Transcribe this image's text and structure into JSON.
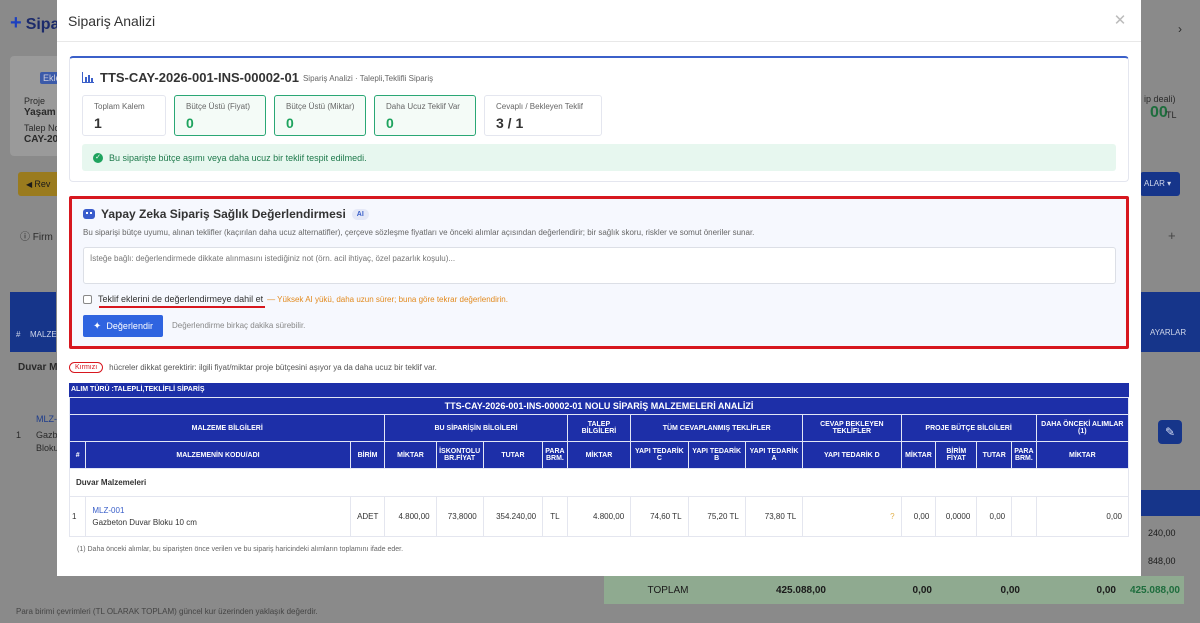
{
  "background": {
    "title": "Sipar",
    "labels": [
      "Ekle",
      "Proje",
      "Yaşam",
      "Talep No",
      "CAY-20",
      "Rev",
      "Firm",
      "#",
      "MALZE",
      "Duvar M",
      "MLZ-",
      "Gazbe",
      "Bloku",
      "1"
    ],
    "right_labels": [
      "ip deali)",
      "00",
      "TL",
      "ALAR",
      "AYARLAR",
      "240,00",
      "848,00"
    ],
    "totals": {
      "label": "TOPLAM",
      "v1": "425.088,00",
      "v2": "0,00",
      "v3": "0,00",
      "v4": "0,00",
      "v5": "425.088,00"
    },
    "footer": "Para birimi çevrimleri (TL OLARAK TOPLAM) güncel kur üzerinden yaklaşık değerdir."
  },
  "modal": {
    "title": "Sipariş Analizi",
    "summary": {
      "code": "TTS-CAY-2026-001-INS-00002-01",
      "subtitle": "Sipariş Analizi · Talepli,Teklifli Sipariş",
      "stats": [
        {
          "label": "Toplam Kalem",
          "value": "1",
          "highlight": false
        },
        {
          "label": "Bütçe Üstü (Fiyat)",
          "value": "0",
          "highlight": true
        },
        {
          "label": "Bütçe Üstü (Miktar)",
          "value": "0",
          "highlight": true
        },
        {
          "label": "Daha Ucuz Teklif Var",
          "value": "0",
          "highlight": true
        },
        {
          "label": "Cevaplı / Bekleyen Teklif",
          "value": "3 / 1",
          "highlight": false
        }
      ],
      "alert": "Bu siparişte bütçe aşımı veya daha ucuz bir teklif tespit edilmedi."
    },
    "ai": {
      "title": "Yapay Zeka Sipariş Sağlık Değerlendirmesi",
      "badge": "AI",
      "description": "Bu siparişi bütçe uyumu, alınan teklifler (kaçırılan daha ucuz alternatifler), çerçeve sözleşme fiyatları ve önceki alımlar açısından değerlendirir; bir sağlık skoru, riskler ve somut öneriler sunar.",
      "textarea_placeholder": "İsteğe bağlı: değerlendirmede dikkate alınmasını istediğiniz not (örn. acil ihtiyaç, özel pazarlık koşulu)...",
      "checkbox_label": "Teklif eklerini de değerlendirmeye dahil et",
      "checkbox_warning": "— Yüksek AI yükü, daha uzun sürer; buna göre tekrar değerlendirin.",
      "button_label": "Değerlendir",
      "button_hint": "Değerlendirme birkaç dakika sürebilir."
    },
    "legend": {
      "pill": "Kırmızı",
      "text": "hücreler dikkat gerektirir: ilgili fiyat/miktar proje bütçesini aşıyor ya da daha ucuz bir teklif var."
    },
    "table": {
      "type_label": "ALIM TÜRÜ :TALEPLİ,TEKLİFLİ SİPARİŞ",
      "title": "TTS-CAY-2026-001-INS-00002-01 NOLU SİPARİŞ MALZEMELERİ ANALİZİ",
      "groups": {
        "malzeme": "MALZEME BİLGİLERİ",
        "siparis": "BU SİPARİŞİN BİLGİLERİ",
        "talep": "TALEP BİLGİLERİ",
        "teklifler": "TÜM CEVAPLANMIŞ TEKLİFLER",
        "bekleyen": "CEVAP BEKLEYEN TEKLİFLER",
        "butce": "PROJE BÜTÇE BİLGİLERİ",
        "onceki": "DAHA ÖNCEKİ ALIMLAR (1)"
      },
      "columns": [
        "#",
        "MALZEMENİN KODU/ADI",
        "BİRİM",
        "MİKTAR",
        "İSKONTOLU BR.FİYAT",
        "TUTAR",
        "PARA BRM.",
        "MİKTAR",
        "YAPI TEDARİK C",
        "YAPI TEDARİK B",
        "YAPI TEDARİK A",
        "YAPI TEDARİK D",
        "MİKTAR",
        "BİRİM FİYAT",
        "TUTAR",
        "PARA BRM.",
        "MİKTAR"
      ],
      "group_label": "Duvar Malzemeleri",
      "rows": [
        {
          "no": "1",
          "code": "MLZ-001",
          "name": "Gazbeton Duvar Bloku 10 cm",
          "unit": "ADET",
          "qty": "4.800,00",
          "price": "73,8000",
          "total": "354.240,00",
          "cur": "TL",
          "req_qty": "4.800,00",
          "c": "74,60 TL",
          "b": "75,20 TL",
          "a": "73,80 TL",
          "d": "?",
          "b_qty": "0,00",
          "b_price": "0,0000",
          "b_total": "0,00",
          "b_cur": "",
          "prev_qty": "0,00"
        }
      ],
      "note": "(1) Daha önceki alımlar, bu siparişten önce verilen ve bu sipariş haricindeki alımların toplamını ifade eder."
    }
  }
}
